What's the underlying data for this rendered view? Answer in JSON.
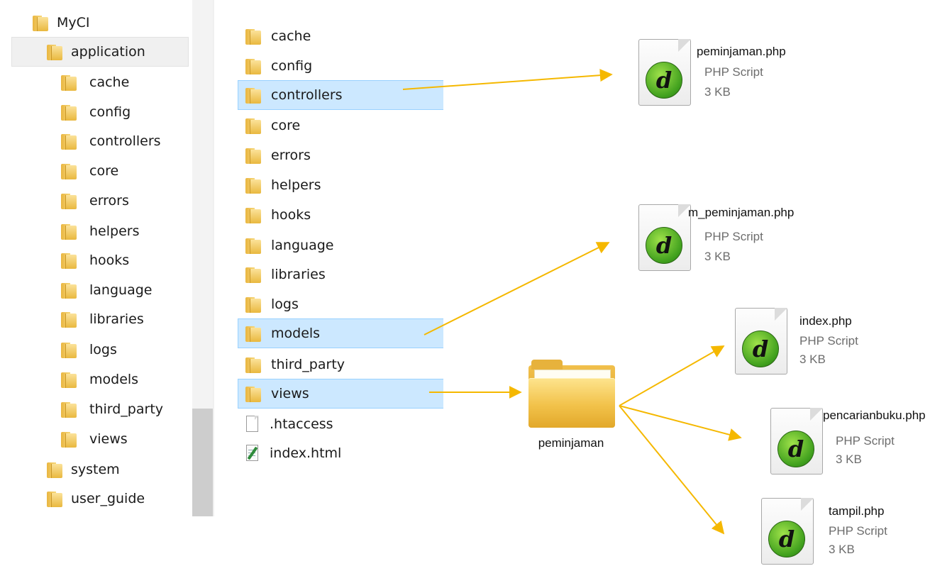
{
  "tree": {
    "root": "MyCI",
    "application": "application",
    "children": [
      "cache",
      "config",
      "controllers",
      "core",
      "errors",
      "helpers",
      "hooks",
      "language",
      "libraries",
      "logs",
      "models",
      "third_party",
      "views"
    ],
    "system": "system",
    "user_guide": "user_guide"
  },
  "list": {
    "folders": [
      "cache",
      "config",
      "controllers",
      "core",
      "errors",
      "helpers",
      "hooks",
      "language",
      "libraries",
      "logs",
      "models",
      "third_party",
      "views"
    ],
    "files": [
      ".htaccess",
      "index.html"
    ]
  },
  "targets": {
    "controller": {
      "name": "peminjaman.php",
      "type": "PHP Script",
      "size": "3 KB"
    },
    "model": {
      "name": "m_peminjaman.php",
      "type": "PHP Script",
      "size": "3 KB"
    },
    "views_folder": "peminjaman",
    "view_files": [
      {
        "name": "index.php",
        "type": "PHP Script",
        "size": "3 KB"
      },
      {
        "name": "pencarianbuku.php",
        "type": "PHP Script",
        "size": "3 KB"
      },
      {
        "name": "tampil.php",
        "type": "PHP Script",
        "size": "3 KB"
      }
    ]
  },
  "colors": {
    "selection": "#cce8ff",
    "selection_border": "#99d1ff",
    "arrow": "#f5b800",
    "folder": "#f2c24a",
    "php_disc": "#4caf24"
  },
  "icons": {
    "folder": "folder-icon",
    "file": "file-icon",
    "html": "html-file-icon",
    "php": "dreamweaver-php-icon"
  }
}
